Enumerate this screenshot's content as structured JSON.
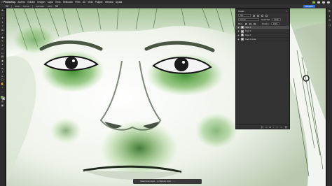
{
  "menubar": {
    "app_name": "Photoshop",
    "items": [
      "Archivo",
      "Edición",
      "Imagen",
      "Capa",
      "Texto",
      "Selección",
      "Filtro",
      "3D",
      "Vista",
      "Plugins",
      "Ventana",
      "Ayuda"
    ]
  },
  "optbar": {
    "mode_label": "Modo:",
    "mode_value": "Normal",
    "opacity_label": "Opacidad:",
    "opacity_value": "100%",
    "share_label": "Compartir"
  },
  "layers_panel": {
    "title": "Capas",
    "filter_label": "Tipo",
    "blend_mode": "Normal",
    "opacity_label": "Opacidad:",
    "opacity_value": "100%",
    "lock_label": "Bloq.:",
    "fill_label": "Relleno:",
    "fill_value": "100%",
    "layers": [
      {
        "name": "Capa 3",
        "selected": true
      },
      {
        "name": "Capa 2",
        "selected": false
      },
      {
        "name": "Capa 1",
        "selected": false
      },
      {
        "name": "Capa 0 copia",
        "selected": false
      }
    ]
  },
  "context_bar": {
    "select_subject": "Seleccionar sujeto",
    "remove_bg": "Eliminar fondo"
  },
  "colors": {
    "foreground": "#6fbf3a",
    "background": "#ffffff",
    "accent": "#2f6fd8"
  }
}
